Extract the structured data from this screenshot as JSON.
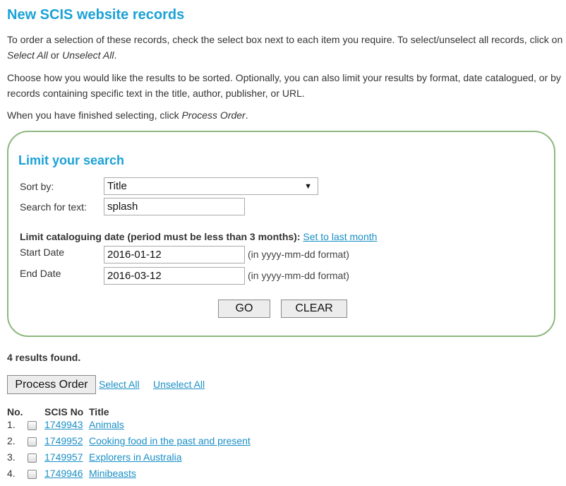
{
  "page": {
    "title": "New SCIS website records",
    "intro1": {
      "text_a": "To order a selection of these records, check the select box next to each item you require. To select/unselect all records, click on ",
      "em_a": "Select All",
      "text_b": " or ",
      "em_b": "Unselect All",
      "text_c": "."
    },
    "intro2": "Choose how you would like the results to be sorted. Optionally, you can also limit your results by format, date catalogued, or by records containing specific text in the title, author, publisher, or URL.",
    "intro3": {
      "text_a": "When you have finished selecting, click ",
      "em_a": "Process Order",
      "text_b": "."
    }
  },
  "limit": {
    "title": "Limit your search",
    "sort_label": "Sort by:",
    "sort_value": "Title",
    "search_label": "Search for text:",
    "search_value": "splash",
    "date_heading": "Limit cataloguing date (period must be less than 3 months):",
    "set_last_month": "Set to last month",
    "start_label": "Start Date",
    "start_value": "2016-01-12",
    "end_label": "End Date",
    "end_value": "2016-03-12",
    "format_hint": "(in yyyy-mm-dd format)",
    "go_label": "GO",
    "clear_label": "CLEAR"
  },
  "results": {
    "count_text": "4 results found.",
    "process_label": "Process Order",
    "select_all": "Select All",
    "unselect_all": "Unselect All",
    "headers": {
      "no": "No.",
      "scis": "SCIS No",
      "title": "Title"
    },
    "rows": [
      {
        "no": "1.",
        "scis": "1749943",
        "title": "Animals"
      },
      {
        "no": "2.",
        "scis": "1749952",
        "title": "Cooking food in the past and present"
      },
      {
        "no": "3.",
        "scis": "1749957",
        "title": "Explorers in Australia"
      },
      {
        "no": "4.",
        "scis": "1749946",
        "title": "Minibeasts"
      }
    ]
  },
  "colors": {
    "heading": "#1aa1d6",
    "link": "#1a8fc6",
    "panel_border": "#8db87e"
  }
}
